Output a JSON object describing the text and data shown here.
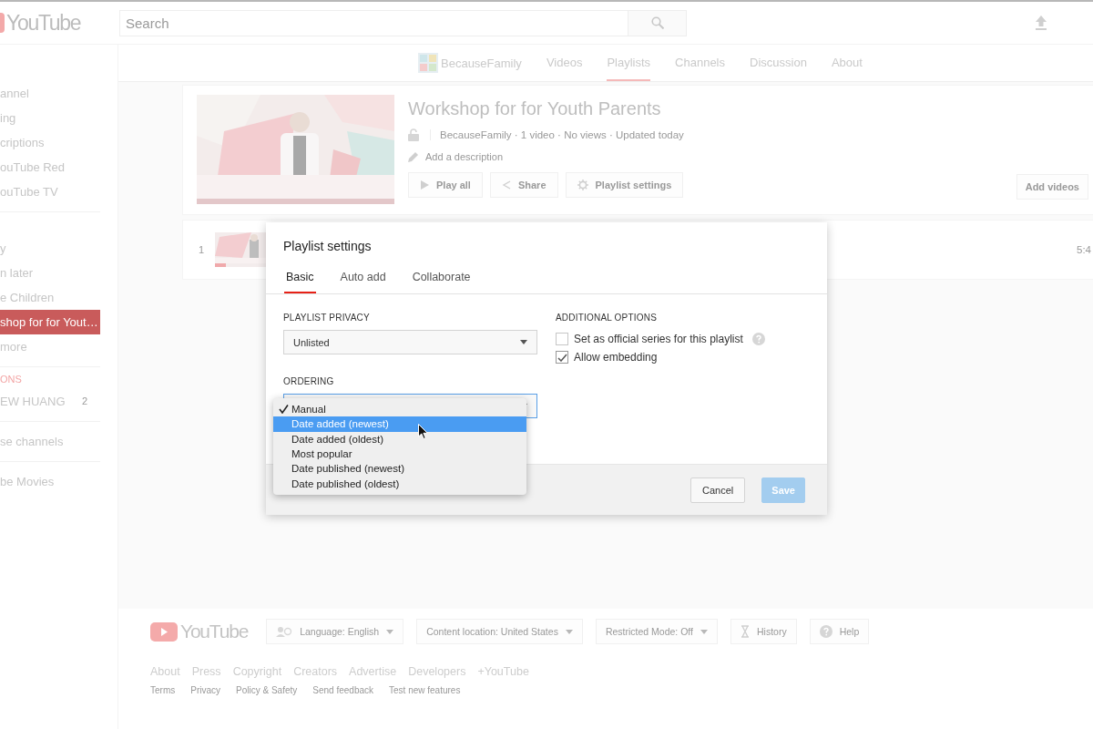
{
  "header": {
    "logo": "YouTube",
    "search": {
      "placeholder": "Search"
    }
  },
  "sidebar": {
    "sections": [
      {
        "items": [
          {
            "label": "annel",
            "selected": false
          },
          {
            "label": "ing",
            "selected": false
          },
          {
            "label": "criptions",
            "selected": false
          },
          {
            "label": "ouTube Red",
            "selected": false
          },
          {
            "label": "ouTube TV",
            "selected": false
          }
        ]
      },
      {
        "items": [
          {
            "label": "y",
            "selected": false
          },
          {
            "label": "n later",
            "selected": false
          },
          {
            "label": "e Children",
            "selected": false
          },
          {
            "label": "shop for for Yout…",
            "selected": true
          },
          {
            "label": "more",
            "selected": false
          }
        ]
      },
      {
        "heading": "ONS",
        "items": [
          {
            "label": "EW HUANG",
            "count": "2",
            "selected": false
          }
        ]
      },
      {
        "items": [
          {
            "label": "se channels",
            "selected": false
          }
        ]
      },
      {
        "items": [
          {
            "label": "be Movies",
            "selected": false
          }
        ]
      }
    ]
  },
  "channel": {
    "name": "BecauseFamily",
    "tabs": [
      {
        "label": "Videos",
        "selected": false
      },
      {
        "label": "Playlists",
        "selected": true
      },
      {
        "label": "Channels",
        "selected": false
      },
      {
        "label": "Discussion",
        "selected": false
      },
      {
        "label": "About",
        "selected": false
      }
    ]
  },
  "playlist": {
    "title": "Workshop for for Youth Parents",
    "meta": "BecauseFamily · 1 video · No views · Updated today",
    "description": "Add a description",
    "actions": [
      {
        "label": "Play all"
      },
      {
        "label": "Share"
      },
      {
        "label": "Playlist settings"
      }
    ],
    "add_button": "Add videos"
  },
  "videos": [
    {
      "index": "1",
      "duration": "5:4"
    }
  ],
  "footer": {
    "logo": "YouTube",
    "controls": [
      {
        "label": "Language: English",
        "dropdown": true
      },
      {
        "label": "Content location: United States",
        "dropdown": true
      },
      {
        "label": "Restricted Mode: Off",
        "dropdown": true
      },
      {
        "label": "History",
        "dropdown": false
      },
      {
        "label": "Help",
        "dropdown": false
      }
    ],
    "links": [
      "About",
      "Press",
      "Copyright",
      "Creators",
      "Advertise",
      "Developers",
      "+YouTube"
    ],
    "small_links": [
      "Terms",
      "Privacy",
      "Policy & Safety",
      "Send feedback",
      "Test new features"
    ]
  },
  "dialog": {
    "title": "Playlist settings",
    "tabs": [
      {
        "label": "Basic",
        "selected": true
      },
      {
        "label": "Auto add",
        "selected": false
      },
      {
        "label": "Collaborate",
        "selected": false
      }
    ],
    "privacy": {
      "label": "PLAYLIST PRIVACY",
      "value": "Unlisted"
    },
    "ordering": {
      "label": "ORDERING",
      "focused": true,
      "options": [
        {
          "label": "Manual",
          "checked": true,
          "highlighted": false
        },
        {
          "label": "Date added (newest)",
          "checked": false,
          "highlighted": true
        },
        {
          "label": "Date added (oldest)",
          "checked": false,
          "highlighted": false
        },
        {
          "label": "Most popular",
          "checked": false,
          "highlighted": false
        },
        {
          "label": "Date published (newest)",
          "checked": false,
          "highlighted": false
        },
        {
          "label": "Date published (oldest)",
          "checked": false,
          "highlighted": false
        }
      ]
    },
    "additional": {
      "label": "ADDITIONAL OPTIONS",
      "options": [
        {
          "label": "Set as official series for this playlist",
          "checked": false,
          "help": true
        },
        {
          "label": "Allow embedding",
          "checked": true,
          "help": false
        }
      ]
    },
    "buttons": [
      {
        "label": "Cancel",
        "kind": "default",
        "disabled": false
      },
      {
        "label": "Save",
        "kind": "primary",
        "disabled": true
      }
    ]
  }
}
